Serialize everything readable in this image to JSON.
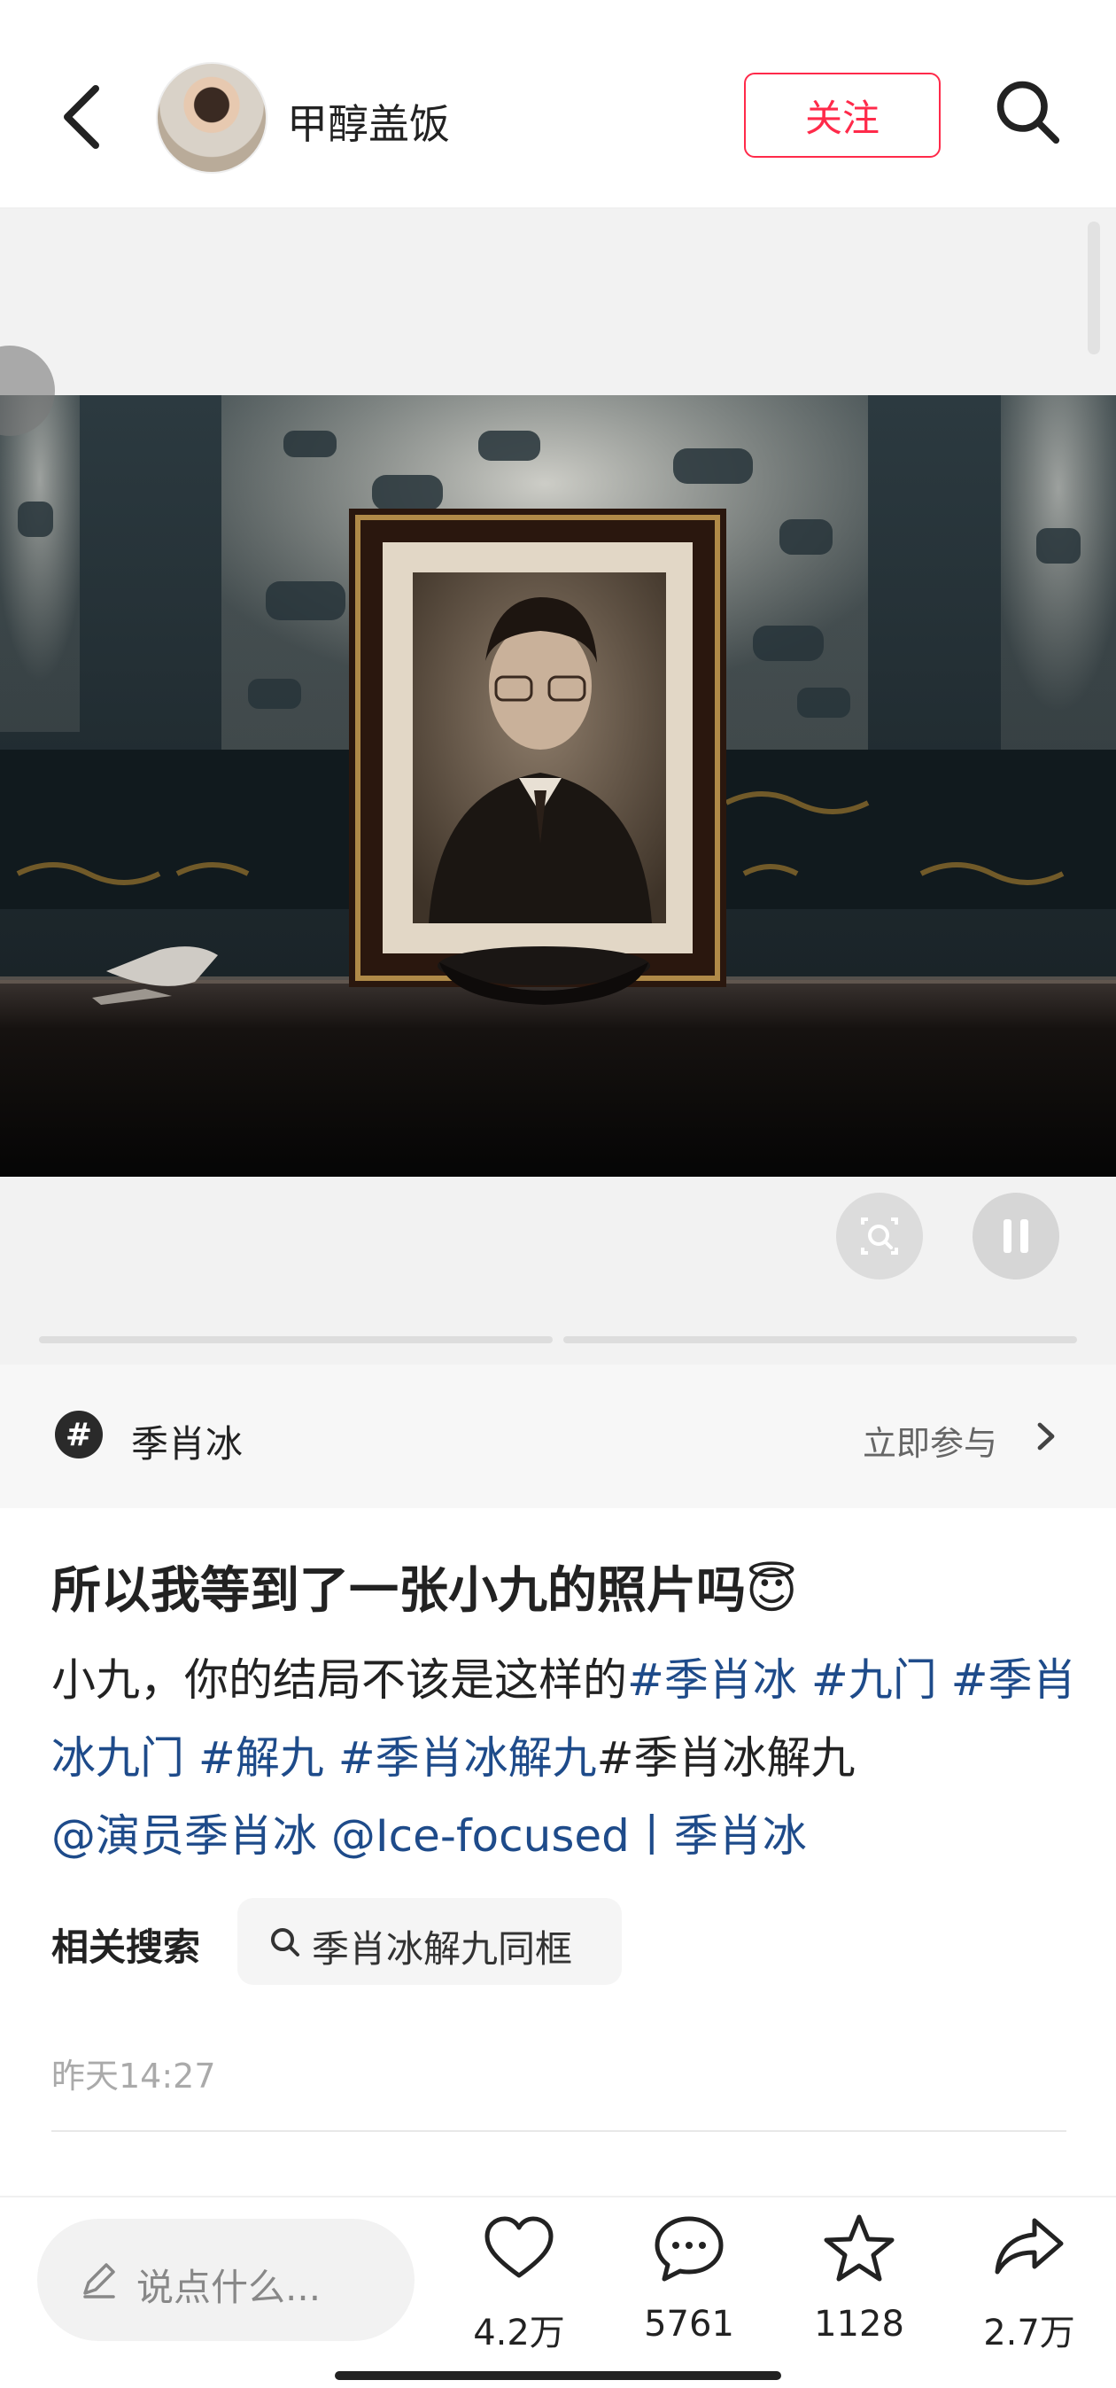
{
  "header": {
    "back_icon": "chevron-left-icon",
    "author_name": "甲醇盖饭",
    "follow_label": "关注",
    "search_icon": "search-icon"
  },
  "media": {
    "controls": {
      "scan_icon": "image-search-icon",
      "pause_icon": "pause-icon"
    }
  },
  "topic": {
    "icon": "#",
    "name": "季肖冰",
    "join_label": "立即参与",
    "chevron_icon": "chevron-right-icon"
  },
  "post": {
    "title": "所以我等到了一张小九的照片吗😇",
    "body_text": "小九，你的结局不该是这样的",
    "tags": [
      "#季肖冰",
      "#九门",
      "#季肖冰九门",
      "#解九",
      "#季肖冰解九"
    ],
    "plain_tag_text": "#季肖冰解九",
    "mentions": [
      "@演员季肖冰",
      "@Ice-focused丨季肖冰"
    ],
    "related_label": "相关搜索",
    "related_search": "季肖冰解九同框",
    "timestamp": "昨天14:27"
  },
  "bottom_bar": {
    "comment_placeholder": "说点什么...",
    "likes": "4.2万",
    "comments": "5761",
    "favorites": "1128",
    "shares": "2.7万"
  },
  "colors": {
    "accent": "#ff2a4a",
    "link": "#1e4b8a"
  }
}
